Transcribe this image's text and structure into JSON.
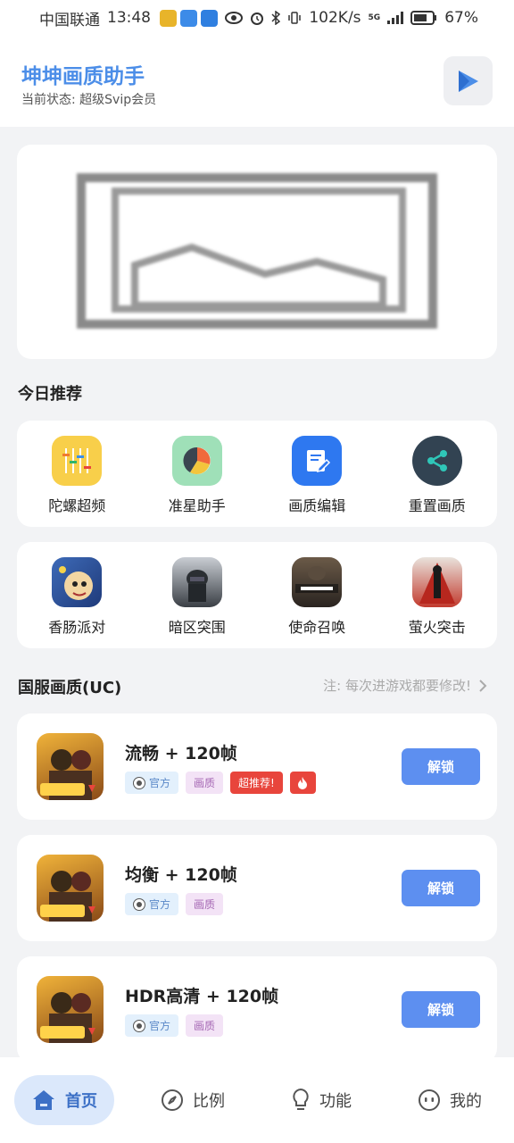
{
  "status_bar": {
    "carrier": "中国联通",
    "time": "13:48",
    "network_speed": "102K/s",
    "signal": "5G",
    "battery": "67%"
  },
  "header": {
    "title": "坤坤画质助手",
    "status": "当前状态:  超级Svip会员",
    "play_icon": "play-icon"
  },
  "banner": {
    "icon": "image-placeholder-icon"
  },
  "today": {
    "title": "今日推荐",
    "tools": [
      {
        "label": "陀螺超频",
        "icon": "equalizer-icon"
      },
      {
        "label": "准星助手",
        "icon": "pie-chart-icon"
      },
      {
        "label": "画质编辑",
        "icon": "edit-doc-icon"
      },
      {
        "label": "重置画质",
        "icon": "share-icon"
      }
    ],
    "games": [
      {
        "label": "香肠派对"
      },
      {
        "label": "暗区突围"
      },
      {
        "label": "使命召唤"
      },
      {
        "label": "萤火突击"
      }
    ]
  },
  "section": {
    "title": "国服画质(UC)",
    "note": "注:  每次进游戏都要修改!"
  },
  "presets": [
    {
      "title": "流畅 + 120帧",
      "tag_official": "官方",
      "tag_quality": "画质",
      "tag_hot": "超推荐!",
      "button": "解锁"
    },
    {
      "title": "均衡 + 120帧",
      "tag_official": "官方",
      "tag_quality": "画质",
      "button": "解锁"
    },
    {
      "title": "HDR高清 + 120帧",
      "tag_official": "官方",
      "tag_quality": "画质",
      "button": "解锁"
    }
  ],
  "tabs": [
    {
      "label": "首页",
      "icon": "home-icon"
    },
    {
      "label": "比例",
      "icon": "compass-icon"
    },
    {
      "label": "功能",
      "icon": "bulb-icon"
    },
    {
      "label": "我的",
      "icon": "face-icon"
    }
  ],
  "colors": {
    "accent": "#4c8ee8",
    "unlock": "#5d8ff0",
    "hot": "#e8453c"
  }
}
